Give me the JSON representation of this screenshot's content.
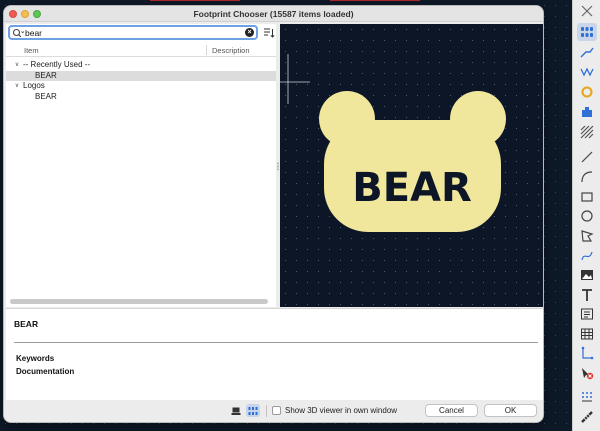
{
  "dialog": {
    "title": "Footprint Chooser (15587 items loaded)"
  },
  "search": {
    "value": "bear",
    "placeholder": ""
  },
  "columns": {
    "item": "Item",
    "description": "Description"
  },
  "tree": {
    "groups": [
      {
        "label": "-- Recently Used --",
        "children": [
          "BEAR"
        ]
      },
      {
        "label": "Logos",
        "children": [
          "BEAR"
        ]
      }
    ]
  },
  "details": {
    "name": "BEAR",
    "keywords_label": "Keywords",
    "documentation_label": "Documentation"
  },
  "bottom": {
    "show3d_label": "Show 3D viewer in own window",
    "show3d_checked": false,
    "cancel_label": "Cancel",
    "ok_label": "OK"
  },
  "preview": {
    "logo_text": "BEAR",
    "logo_color": "#f0e69c",
    "text_color": "#0c1626",
    "background": "#0c1626"
  },
  "toolbar_icons": [
    "cross-icon",
    "grid-pad-icon",
    "route-track-icon",
    "diff-pair-icon",
    "via-icon",
    "component-icon",
    "zone-icon",
    "line-icon",
    "arc-icon",
    "rectangle-icon",
    "circle-icon",
    "polygon-icon",
    "curve-icon",
    "image-icon",
    "text-icon",
    "textbox-icon",
    "table-icon",
    "dimension-icon",
    "delete-icon",
    "array-icon",
    "ruler-icon"
  ],
  "colors": {
    "accent": "#6ea0e4",
    "selection": "#dcdcdc",
    "toolbar_active": "#c9d6ea"
  }
}
